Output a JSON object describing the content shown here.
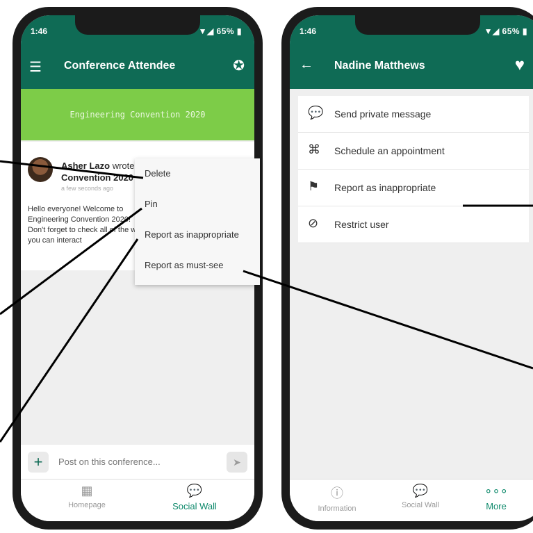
{
  "left_phone": {
    "status": {
      "time": "1:46",
      "battery": "65%"
    },
    "app_title": "Conference Attendee",
    "banner": "Engineering Convention 2020",
    "post": {
      "author": "Asher Lazo",
      "wrote_on": "wrote on",
      "target": "Engineering Convention 2020",
      "time": "a few seconds ago",
      "text": "Hello everyone! Welcome to Engineering Convention 2020! Don't forget to check all of the ways you can interact"
    },
    "menu": [
      "Delete",
      "Pin",
      "Report as inappropriate",
      "Report as must-see"
    ],
    "composer_placeholder": "Post on this conference...",
    "tabs": [
      "Homepage",
      "Social Wall"
    ]
  },
  "right_phone": {
    "status": {
      "time": "1:46",
      "battery": "65%"
    },
    "title": "Nadine Matthews",
    "actions": [
      "Send private message",
      "Schedule an appointment",
      "Report as inappropriate",
      "Restrict user"
    ],
    "tabs": [
      "Information",
      "Social Wall",
      "More"
    ]
  }
}
